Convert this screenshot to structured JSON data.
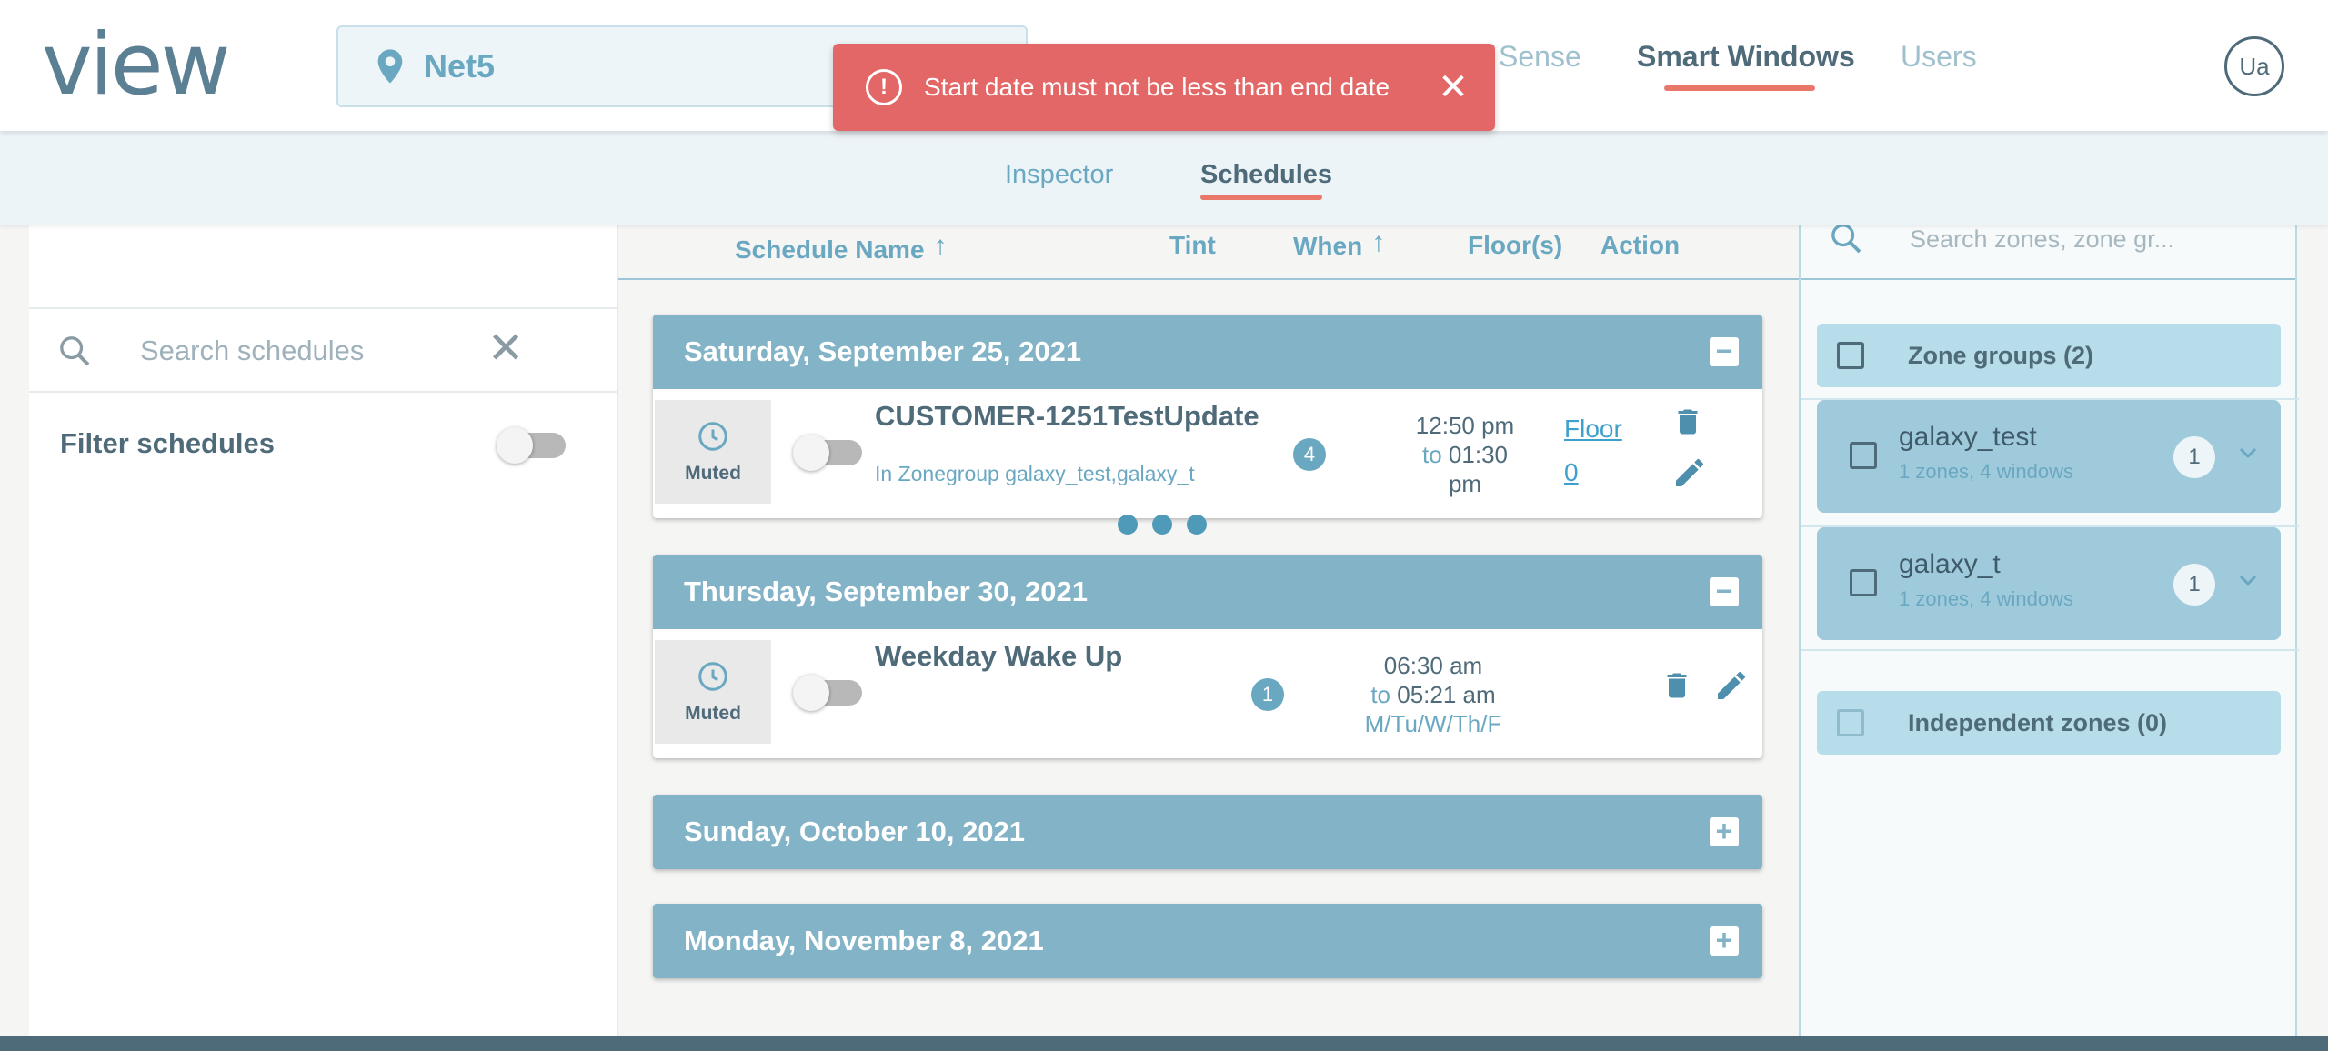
{
  "app": {
    "logo": "view"
  },
  "header": {
    "site": "Net5",
    "nav": [
      "Sense",
      "Smart Windows",
      "Users"
    ],
    "active_nav": "Smart Windows",
    "avatar": "Ua"
  },
  "toast": {
    "message": "Start date must not be less than end date",
    "icon": "alert-circle-icon"
  },
  "subnav": {
    "tabs": [
      "Inspector",
      "Schedules"
    ],
    "active": "Schedules"
  },
  "left": {
    "search_placeholder": "Search schedules",
    "filter_label": "Filter schedules",
    "filter_on": false
  },
  "columns": {
    "name": "Schedule Name",
    "tint": "Tint",
    "when": "When",
    "floors": "Floor(s)",
    "action": "Action"
  },
  "days": [
    {
      "title": "Saturday, September 25, 2021",
      "expanded": true,
      "schedule": {
        "muted": "Muted",
        "name": "CUSTOMER-1251TestUpdate",
        "zone": "In Zonegroup galaxy_test,galaxy_t",
        "tint": "4",
        "from": "12:50 pm",
        "to_word": "to",
        "to": "01:30",
        "to2": "pm",
        "floor1": "Floor",
        "floor2": "0"
      }
    },
    {
      "title": "Thursday, September 30, 2021",
      "expanded": true,
      "schedule": {
        "muted": "Muted",
        "name": "Weekday Wake Up",
        "tint": "1",
        "from": "06:30 am",
        "to_word": "to",
        "to": "05:21 am",
        "days": "M/Tu/W/Th/F"
      }
    },
    {
      "title": "Sunday, October 10, 2021",
      "expanded": false
    },
    {
      "title": "Monday, November 8, 2021",
      "expanded": false
    }
  ],
  "right": {
    "search_placeholder": "Search zones, zone gr...",
    "zone_groups_label": "Zone groups (2)",
    "zone_groups": [
      {
        "name": "galaxy_test",
        "sub": "1 zones, 4 windows",
        "count": "1"
      },
      {
        "name": "galaxy_t",
        "sub": "1 zones, 4 windows",
        "count": "1"
      }
    ],
    "independent_label": "Independent zones (0)"
  },
  "colors": {
    "accent": "#e9786a",
    "primary": "#82b3c7",
    "text": "#4f6b7a",
    "toast": "#e36767"
  }
}
